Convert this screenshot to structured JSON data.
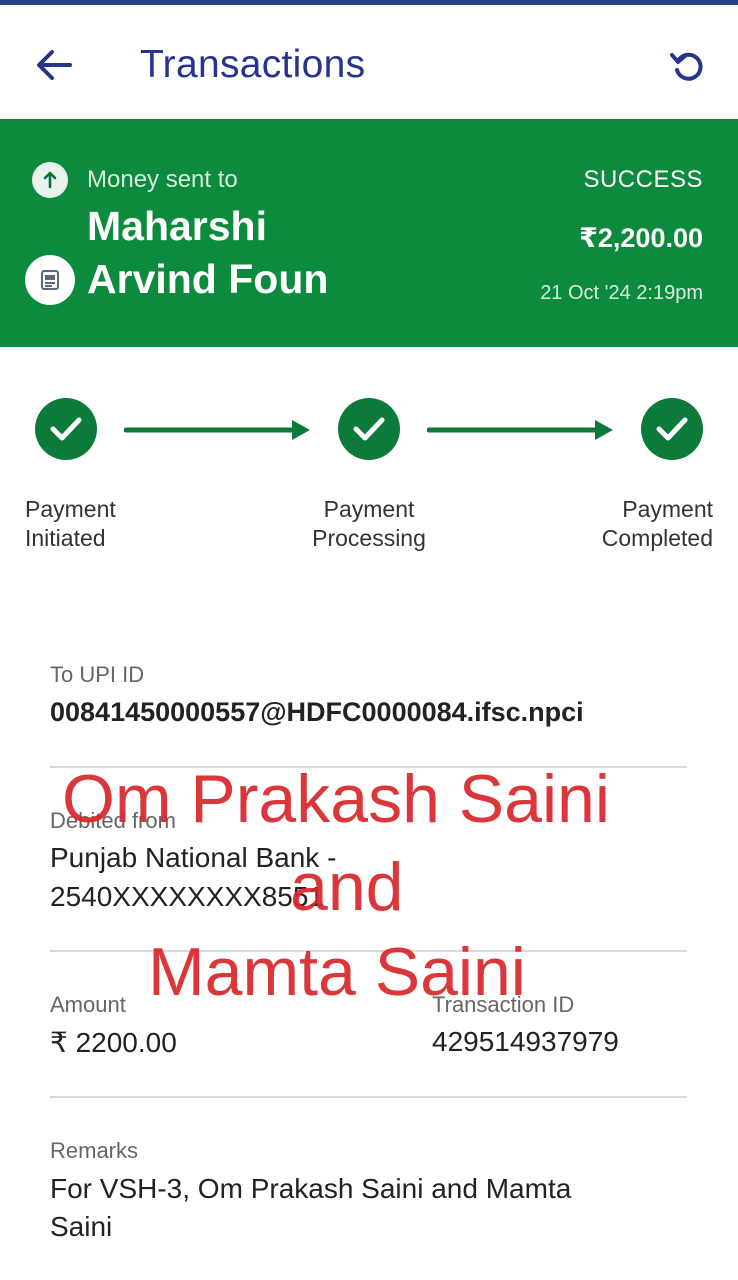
{
  "header": {
    "title": "Transactions",
    "back_icon": "arrow-left-icon",
    "refresh_icon": "refresh-icon"
  },
  "banner": {
    "sent_label": "Money sent to",
    "payee_line1": "Maharshi",
    "payee_line2": "Arvind Foun",
    "status": "SUCCESS",
    "amount": "₹2,200.00",
    "datetime": "21 Oct '24 2:19pm",
    "color": "#0c8a3e"
  },
  "progress": {
    "steps": [
      {
        "line1": "Payment",
        "line2": "Initiated"
      },
      {
        "line1": "Payment",
        "line2": "Processing"
      },
      {
        "line1": "Payment",
        "line2": "Completed"
      }
    ]
  },
  "details": {
    "upi_label": "To UPI ID",
    "upi_value": "00841450000557@HDFC0000084.ifsc.npci",
    "debit_label": "Debited from",
    "debit_line1": "Punjab National Bank -",
    "debit_line2": "2540XXXXXXXX8551",
    "amount_label": "Amount",
    "amount_value": "₹ 2200.00",
    "txn_label": "Transaction ID",
    "txn_value": "429514937979",
    "remarks_label": "Remarks",
    "remarks_line1": "For VSH-3, Om Prakash Saini and Mamta",
    "remarks_line2": "Saini"
  },
  "overlay": {
    "line1": "Om Prakash Saini",
    "line2": "and",
    "line3": "Mamta Saini"
  }
}
